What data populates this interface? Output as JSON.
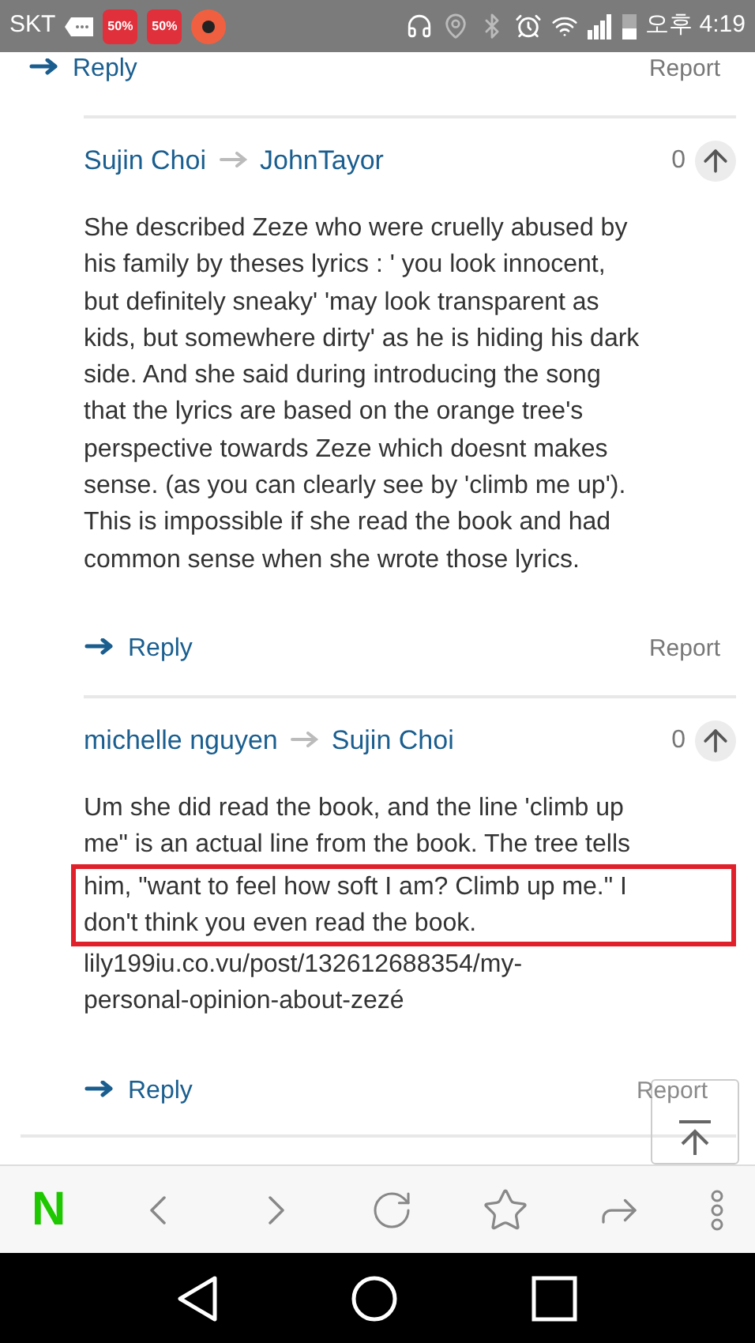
{
  "status_bar": {
    "carrier": "SKT",
    "badges": [
      "50%",
      "50%"
    ],
    "time": "오후 4:19"
  },
  "top_actions": {
    "reply": "Reply",
    "report": "Report"
  },
  "comments": [
    {
      "author": "Sujin Choi",
      "reply_to": "JohnTayor",
      "votes": "0",
      "lines": [
        {
          "text": "She described Zeze who were cruelly abused by",
          "highlighted": false
        },
        {
          "text": "his family by theses lyrics : ' you look innocent,",
          "highlighted": false
        },
        {
          "text": "but definitely sneaky' 'may look transparent as",
          "highlighted": false
        },
        {
          "text": "kids, but somewhere dirty' as he is hiding his dark",
          "highlighted": false
        },
        {
          "text": "side. And she said during introducing the song",
          "highlighted": false
        },
        {
          "text": "that the lyrics are based on the orange tree's",
          "highlighted": false
        },
        {
          "text": "perspective towards Zeze which doesnt makes",
          "highlighted": false
        },
        {
          "text": "sense. (as you can clearly see by 'climb me up').",
          "highlighted": false
        },
        {
          "text": "This is impossible if she read the book and had",
          "highlighted": false
        },
        {
          "text": "common sense when she wrote those lyrics.",
          "highlighted": false
        }
      ],
      "reply": "Reply",
      "report": "Report"
    },
    {
      "author": "michelle nguyen",
      "reply_to": "Sujin Choi",
      "votes": "0",
      "lines": [
        {
          "text": "Um she did read the book, and the line 'climb up",
          "highlighted": false
        },
        {
          "text": "me\" is an actual line from the book. The tree tells",
          "highlighted": false
        },
        {
          "text": "him, \"want to feel how soft I am? Climb up me.\" I",
          "highlighted": true
        },
        {
          "text": "don't think you even read the book.",
          "highlighted": true
        },
        {
          "text": "lily199iu.co.vu/post/132612688354/my-",
          "highlighted": false
        },
        {
          "text": "personal-opinion-about-zezé",
          "highlighted": false
        }
      ],
      "reply": "Reply",
      "report": "Report"
    }
  ],
  "browser_toolbar": {
    "logo": "N"
  }
}
